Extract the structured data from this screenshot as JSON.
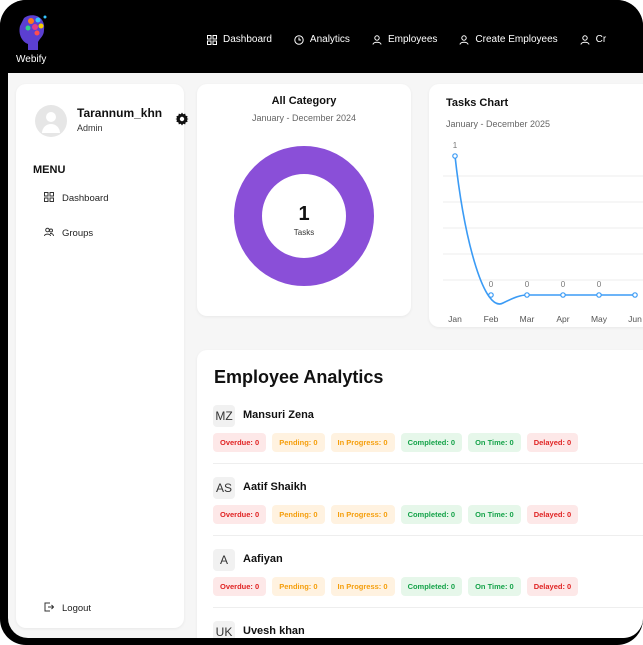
{
  "app": {
    "name": "Webify"
  },
  "nav": [
    {
      "label": "Dashboard",
      "icon": "grid-icon"
    },
    {
      "label": "Analytics",
      "icon": "clock-icon"
    },
    {
      "label": "Employees",
      "icon": "user-icon"
    },
    {
      "label": "Create Employees",
      "icon": "user-icon"
    },
    {
      "label": "Cr",
      "icon": "user-icon"
    }
  ],
  "sidebar": {
    "username": "Tarannum_khn",
    "role": "Admin",
    "menu_title": "MENU",
    "items": [
      {
        "label": "Dashboard",
        "icon": "grid-icon"
      },
      {
        "label": "Groups",
        "icon": "users-icon"
      }
    ],
    "logout": "Logout"
  },
  "category_card": {
    "title": "All Category",
    "subtitle": "January - December 2024",
    "center_value": "1",
    "center_label": "Tasks"
  },
  "tasks_card": {
    "title": "Tasks Chart",
    "subtitle": "January - December 2025"
  },
  "chart_data": [
    {
      "type": "pie",
      "title": "All Category",
      "subtitle": "January - December 2024",
      "slices": [
        {
          "label": "",
          "value": 1,
          "color": "#8a4fd8"
        }
      ],
      "center_text": "1",
      "center_label": "Tasks"
    },
    {
      "type": "line",
      "title": "Tasks Chart",
      "subtitle": "January - December 2025",
      "categories": [
        "Jan",
        "Feb",
        "Mar",
        "Apr",
        "May",
        "Jun"
      ],
      "values": [
        1,
        0,
        0,
        0,
        0,
        0
      ],
      "data_labels": [
        "1",
        "0",
        "0",
        "0",
        "0",
        ""
      ],
      "grid": true,
      "color": "#3b9bf5"
    }
  ],
  "employee_analytics": {
    "title": "Employee Analytics",
    "employees": [
      {
        "initials": "MZ",
        "name": "Mansuri Zena",
        "stats": [
          "Overdue: 0",
          "Pending: 0",
          "In Progress: 0",
          "Completed: 0",
          "On Time: 0",
          "Delayed: 0"
        ]
      },
      {
        "initials": "AS",
        "name": "Aatif Shaikh",
        "stats": [
          "Overdue: 0",
          "Pending: 0",
          "In Progress: 0",
          "Completed: 0",
          "On Time: 0",
          "Delayed: 0"
        ]
      },
      {
        "initials": "A",
        "name": "Aafiyan",
        "stats": [
          "Overdue: 0",
          "Pending: 0",
          "In Progress: 0",
          "Completed: 0",
          "On Time: 0",
          "Delayed: 0"
        ]
      },
      {
        "initials": "UK",
        "name": "Uvesh khan",
        "stats": []
      }
    ]
  },
  "colors": {
    "donut": "#8a4fd8",
    "line": "#3b9bf5",
    "overdue": "#e02424",
    "pending": "#f59e0b",
    "completed": "#16a34a"
  }
}
